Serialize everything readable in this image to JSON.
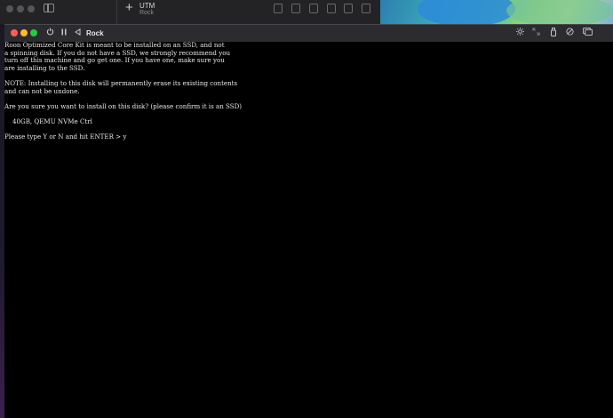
{
  "background_window": {
    "title": "UTM",
    "subtitle": "Rock"
  },
  "vm_window": {
    "title": "Rock",
    "toolbar_icons": [
      "power-icon",
      "pause-icon",
      "back-icon",
      "brightness-icon",
      "resize-icon",
      "usb-icon",
      "shared-folder-icon",
      "display-icon"
    ]
  },
  "console": {
    "lines": [
      "Roon Optimized Core Kit is meant to be installed on an SSD, and not",
      "a spinning disk. If you do not have a SSD, we strongly recommend you",
      "turn off this machine and go get one. If you have one, make sure you",
      "are installing to the SSD.",
      "",
      "NOTE: Installing to this disk will permanently erase its existing contents",
      "and can not be undone.",
      "",
      "Are you sure you want to install on this disk? (please confirm it is an SSD)",
      "",
      "    40GB, QEMU NVMe Ctrl",
      "",
      "Please type Y or N and hit ENTER > y"
    ]
  }
}
